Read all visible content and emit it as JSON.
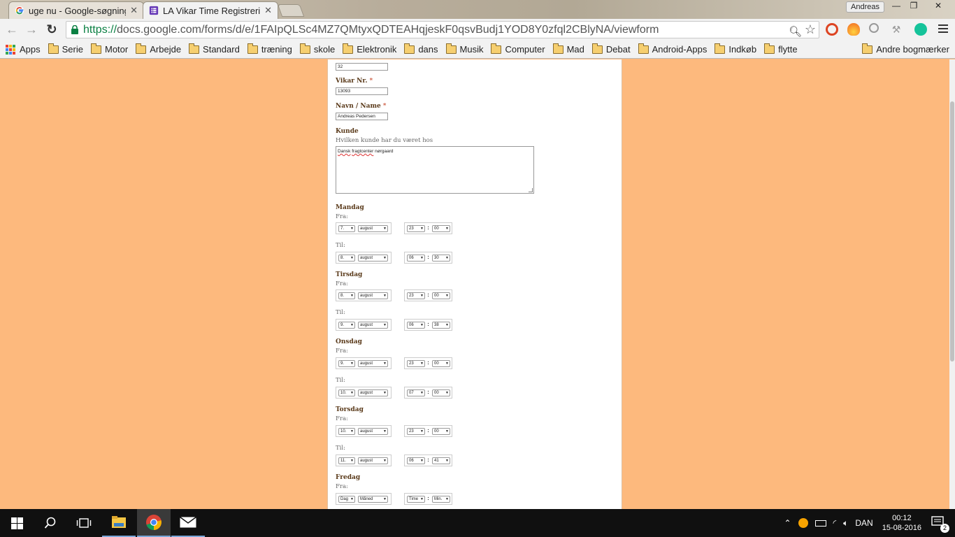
{
  "browser": {
    "tabs": [
      {
        "title": "uge nu - Google-søgning",
        "active": false,
        "icon": "google-icon"
      },
      {
        "title": "LA Vikar Time Registrering",
        "active": true,
        "icon": "google-forms-icon"
      }
    ],
    "profile_name": "Andreas",
    "url_https": "https://",
    "url_rest": "docs.google.com/forms/d/e/1FAIpQLSc4MZ7QMtyxQDTEAHqjeskF0qsvBudj1YOD8Y0zfql2CBlyNA/viewform"
  },
  "bookmarks": {
    "apps_label": "Apps",
    "items": [
      "Serie",
      "Motor",
      "Arbejde",
      "Standard",
      "træning",
      "skole",
      "Elektronik",
      "dans",
      "Musik",
      "Computer",
      "Mad",
      "Debat",
      "Android-Apps",
      "Indkøb",
      "flytte"
    ],
    "other_label": "Andre bogmærker"
  },
  "form": {
    "top_value": "32",
    "vikar_nr": {
      "label": "Vikar Nr.",
      "required_mark": "*",
      "value": "13093"
    },
    "navn": {
      "label": "Navn / Name",
      "required_mark": "*",
      "value": "Andreas Pedersen"
    },
    "kunde": {
      "label": "Kunde",
      "help": "Hvilken kunde har du været hos",
      "value_word1": "Dansk",
      "value_word2": "fragtcenter",
      "value_word3": "nørgaard"
    },
    "fra_label": "Fra:",
    "til_label": "Til:",
    "days": [
      {
        "name": "Mandag",
        "fra": {
          "day": "7.",
          "month": "august",
          "hour": "23",
          "min": "00"
        },
        "til": {
          "day": "8.",
          "month": "august",
          "hour": "06",
          "min": "30"
        }
      },
      {
        "name": "Tirsdag",
        "fra": {
          "day": "8.",
          "month": "august",
          "hour": "23",
          "min": "00"
        },
        "til": {
          "day": "9.",
          "month": "august",
          "hour": "06",
          "min": "38"
        }
      },
      {
        "name": "Onsdag",
        "fra": {
          "day": "9.",
          "month": "august",
          "hour": "23",
          "min": "00"
        },
        "til": {
          "day": "10.",
          "month": "august",
          "hour": "07",
          "min": "00"
        }
      },
      {
        "name": "Torsdag",
        "fra": {
          "day": "10.",
          "month": "august",
          "hour": "23",
          "min": "00"
        },
        "til": {
          "day": "11.",
          "month": "august",
          "hour": "06",
          "min": "41"
        }
      },
      {
        "name": "Fredag",
        "fra": {
          "day": "Dag",
          "month": "Måned",
          "hour": "Time",
          "min": "Min."
        }
      }
    ]
  },
  "taskbar": {
    "language": "DAN",
    "time": "00:12",
    "date": "15-08-2016",
    "notification_count": "2"
  },
  "colors": {
    "page_background": "#fdb97d",
    "form_card": "#ffffff",
    "url_secure_green": "#0b8043",
    "required_red": "#c43b1d"
  }
}
